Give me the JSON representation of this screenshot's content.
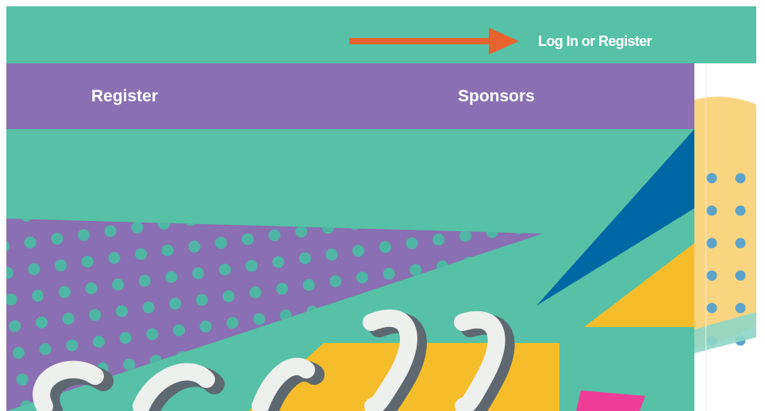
{
  "topbar": {
    "login_link": "Log In or Register"
  },
  "nav": {
    "items": [
      {
        "label": "Register"
      },
      {
        "label": "Sponsors"
      }
    ]
  },
  "colors": {
    "teal": "#56c1a6",
    "purple": "#8a6fb2",
    "dot_teal": "#4fb5a5",
    "blue": "#0067a5",
    "yellow": "#f5bd2a",
    "pink": "#ee3d96",
    "orange_arrow": "#e8622f",
    "peach": "#f9d582",
    "script_white": "#eef0ee",
    "script_shadow": "#5e6870"
  },
  "icons": {
    "annotation": "right-arrow-icon"
  }
}
